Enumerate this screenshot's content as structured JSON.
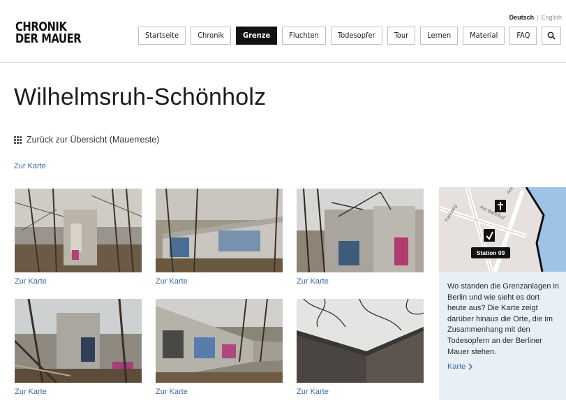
{
  "header": {
    "logo_line1": "CHRONIK",
    "logo_line2": "DER MAUER",
    "lang_active": "Deutsch",
    "lang_separator": "|",
    "lang_other": "English",
    "nav": [
      {
        "label": "Startseite",
        "active": false
      },
      {
        "label": "Chronik",
        "active": false
      },
      {
        "label": "Grenze",
        "active": true
      },
      {
        "label": "Fluchten",
        "active": false
      },
      {
        "label": "Todesopfer",
        "active": false
      },
      {
        "label": "Tour",
        "active": false
      },
      {
        "label": "Lernen",
        "active": false
      },
      {
        "label": "Material",
        "active": false
      },
      {
        "label": "FAQ",
        "active": false
      }
    ],
    "search_icon": "search-icon"
  },
  "main": {
    "title": "Wilhelmsruh-Schönholz",
    "back_link": "Zurück zur Übersicht (Mauerreste)",
    "back_icon": "grid-icon",
    "map_link": "Zur Karte"
  },
  "gallery": [
    {
      "caption": "Zur Karte"
    },
    {
      "caption": "Zur Karte"
    },
    {
      "caption": "Zur Karte"
    },
    {
      "caption": "Zur Karte"
    },
    {
      "caption": "Zur Karte"
    },
    {
      "caption": "Zur Karte"
    }
  ],
  "sidebar": {
    "map": {
      "station_label": "Station 09",
      "streets": [
        "Parkweg",
        "Am Bahnhof",
        "Am der Schönholzer Heide"
      ]
    },
    "info_text": "Wo standen die Grenzanlagen in Berlin und wie sieht es dort heute aus? Die Karte zeigt darüber hinaus die Orte, die im Zusammenhang mit den Todesopfern an der Berliner Mauer stehen.",
    "link_label": "Karte",
    "link_icon": "chevron-right-icon"
  },
  "colors": {
    "accent_link": "#3a6aa8",
    "nav_active_bg": "#111111",
    "info_bg": "#e9f0f5",
    "map_water": "#9fc3e6"
  }
}
